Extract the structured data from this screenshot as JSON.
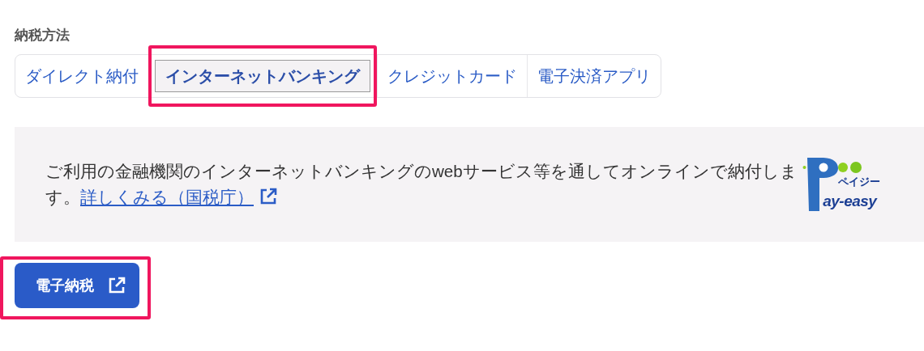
{
  "section": {
    "heading": "納税方法"
  },
  "tabs": [
    {
      "label": "ダイレクト納付",
      "selected": false,
      "highlighted": false
    },
    {
      "label": "インターネットバンキング",
      "selected": true,
      "highlighted": true
    },
    {
      "label": "クレジットカード",
      "selected": false,
      "highlighted": false
    },
    {
      "label": "電子決済アプリ",
      "selected": false,
      "highlighted": false
    }
  ],
  "info": {
    "text": "ご利用の金融機関のインターネットバンキングのwebサービス等を通してオンラインで納付します。",
    "link": "詳しくみる（国税庁）"
  },
  "logo": {
    "kana": "ペイジー",
    "wordmark": "ay-easy"
  },
  "button": {
    "label": "電子納税",
    "highlighted": true
  }
}
